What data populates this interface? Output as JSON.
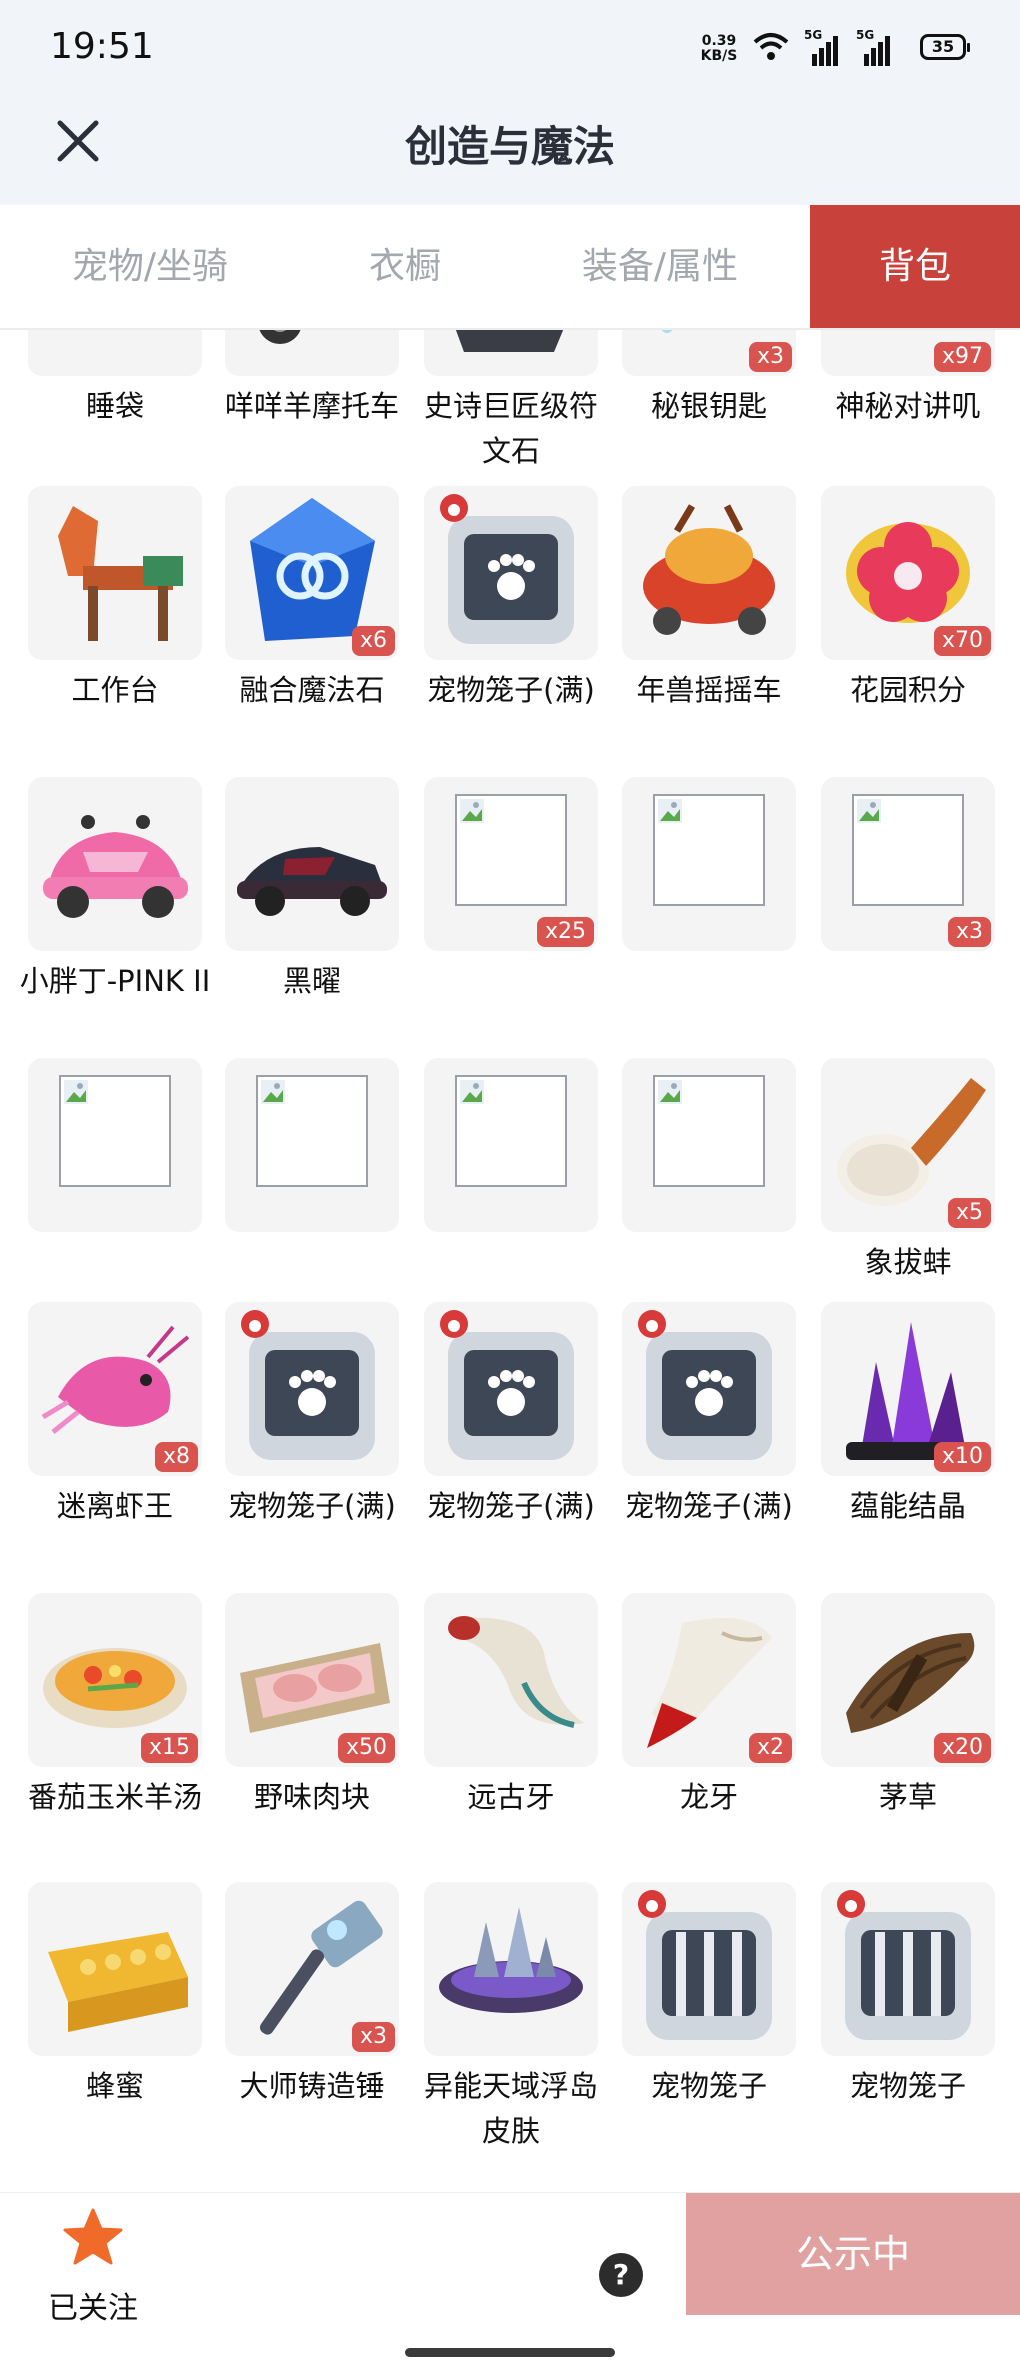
{
  "status_bar": {
    "time": "19:51",
    "net_speed_value": "0.39",
    "net_speed_unit": "KB/S",
    "sim1": "5G",
    "sim2": "5G",
    "battery": "35"
  },
  "header": {
    "title": "创造与魔法",
    "close_icon": "close-icon"
  },
  "tabs": [
    {
      "label": "宠物/坐骑",
      "active": false
    },
    {
      "label": "衣橱",
      "active": false
    },
    {
      "label": "装备/属性",
      "active": false
    },
    {
      "label": "背包",
      "active": true
    }
  ],
  "accent_color": "#c8413a",
  "items": [
    {
      "name": "睡袋",
      "qty": "",
      "icon": "blue-sleeping-bag-icon"
    },
    {
      "name": "咩咩羊摩托车",
      "qty": "",
      "icon": "sheep-scooter-icon"
    },
    {
      "name": "史诗巨匠级符文石",
      "qty": "",
      "icon": "rune-stone-icon"
    },
    {
      "name": "秘银钥匙",
      "qty": "x3",
      "icon": "mithril-key-icon"
    },
    {
      "name": "神秘对讲叽",
      "qty": "x97",
      "icon": "walkie-talkie-icon"
    },
    {
      "name": "工作台",
      "qty": "",
      "icon": "horse-workbench-icon"
    },
    {
      "name": "融合魔法石",
      "qty": "x6",
      "icon": "magic-crystal-icon"
    },
    {
      "name": "宠物笼子(满)",
      "qty": "",
      "icon": "pet-cage-full-icon"
    },
    {
      "name": "年兽摇摇车",
      "qty": "",
      "icon": "nian-rocking-car-icon"
    },
    {
      "name": "花园积分",
      "qty": "x70",
      "icon": "garden-flower-icon"
    },
    {
      "name": "小胖丁-PINK II",
      "qty": "",
      "icon": "pink-beetle-car-icon"
    },
    {
      "name": "黑曜",
      "qty": "",
      "icon": "black-sports-car-icon"
    },
    {
      "name": "",
      "qty": "x25",
      "icon": "broken-image-icon"
    },
    {
      "name": "",
      "qty": "",
      "icon": "broken-image-icon"
    },
    {
      "name": "",
      "qty": "x3",
      "icon": "broken-image-icon"
    },
    {
      "name": "",
      "qty": "",
      "icon": "broken-image-icon"
    },
    {
      "name": "",
      "qty": "",
      "icon": "broken-image-icon"
    },
    {
      "name": "",
      "qty": "",
      "icon": "broken-image-icon"
    },
    {
      "name": "",
      "qty": "",
      "icon": "broken-image-icon"
    },
    {
      "name": "象拔蚌",
      "qty": "x5",
      "icon": "geoduck-icon"
    },
    {
      "name": "迷离虾王",
      "qty": "x8",
      "icon": "shrimp-king-icon"
    },
    {
      "name": "宠物笼子(满)",
      "qty": "",
      "icon": "pet-cage-full-icon"
    },
    {
      "name": "宠物笼子(满)",
      "qty": "",
      "icon": "pet-cage-full-icon"
    },
    {
      "name": "宠物笼子(满)",
      "qty": "",
      "icon": "pet-cage-full-icon"
    },
    {
      "name": "蕴能结晶",
      "qty": "x10",
      "icon": "purple-crystal-icon"
    },
    {
      "name": "番茄玉米羊汤",
      "qty": "x15",
      "icon": "soup-bowl-icon"
    },
    {
      "name": "野味肉块",
      "qty": "x50",
      "icon": "meat-tray-icon"
    },
    {
      "name": "远古牙",
      "qty": "",
      "icon": "ancient-horn-icon"
    },
    {
      "name": "龙牙",
      "qty": "x2",
      "icon": "dragon-tooth-icon"
    },
    {
      "name": "茅草",
      "qty": "x20",
      "icon": "thatch-bundle-icon"
    },
    {
      "name": "蜂蜜",
      "qty": "",
      "icon": "honeycomb-icon"
    },
    {
      "name": "大师铸造锤",
      "qty": "x3",
      "icon": "forge-hammer-icon"
    },
    {
      "name": "异能天域浮岛皮肤",
      "qty": "",
      "icon": "floating-island-icon"
    },
    {
      "name": "宠物笼子",
      "qty": "",
      "icon": "pet-cage-empty-icon"
    },
    {
      "name": "宠物笼子",
      "qty": "",
      "icon": "pet-cage-empty-icon"
    }
  ],
  "bottom_bar": {
    "follow_label": "已关注",
    "help_symbol": "?",
    "publicity_label": "公示中"
  }
}
